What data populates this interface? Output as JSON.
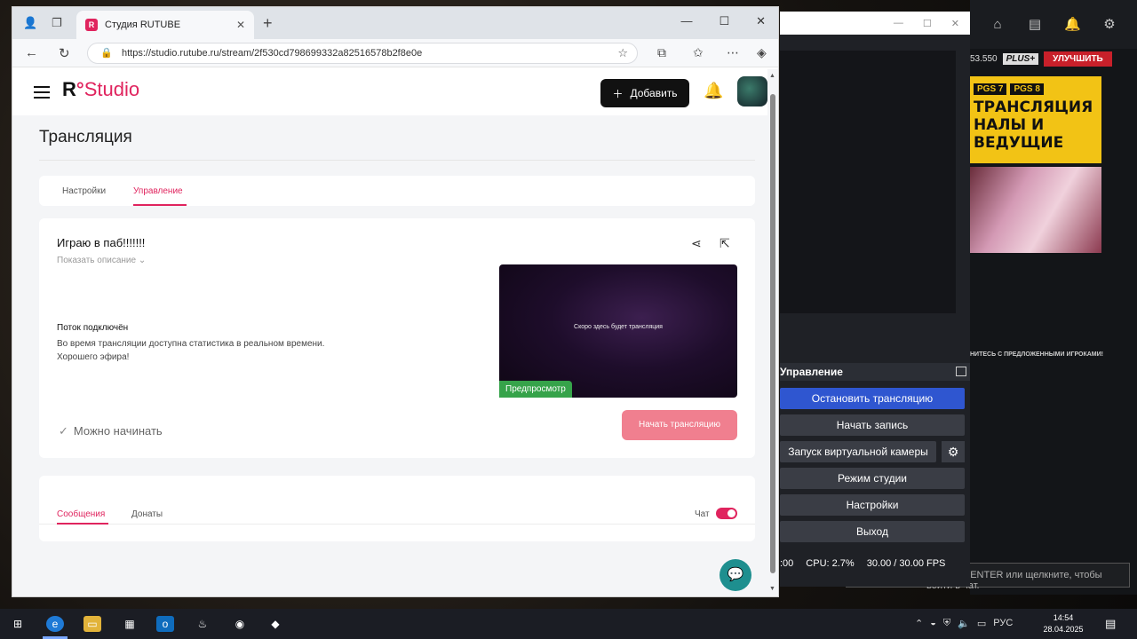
{
  "browser": {
    "tab_title": "Студия RUTUBE",
    "url": "https://studio.rutube.ru/stream/2f530cd798699332a82516578b2f8e0e"
  },
  "header": {
    "logo_r": "R",
    "logo_studio": "Studio",
    "add_button": "Добавить"
  },
  "page": {
    "title": "Трансляция",
    "tabs": [
      {
        "label": "Настройки"
      },
      {
        "label": "Управление"
      }
    ],
    "stream": {
      "title": "Играю в паб!!!!!!!",
      "show_description": "Показать описание",
      "status_heading": "Поток подключён",
      "status_text": "Во время трансляции доступна статистика в реальном времени. Хорошего эфира!",
      "preview_text": "Скоро здесь будет трансляция",
      "preview_badge": "Предпросмотр",
      "ready_text": "Можно начинать",
      "start_button": "Начать трансляцию"
    },
    "chat": {
      "tabs": [
        {
          "label": "Сообщения"
        },
        {
          "label": "Донаты"
        }
      ],
      "chat_label": "Чат"
    }
  },
  "obs": {
    "controls_title": "Управление",
    "buttons": [
      {
        "label": "Остановить трансляцию"
      },
      {
        "label": "Начать запись"
      },
      {
        "label": "Запуск виртуальной камеры"
      },
      {
        "label": "Режим студии"
      },
      {
        "label": "Настройки"
      },
      {
        "label": "Выход"
      }
    ],
    "status_time": ":00",
    "cpu": "CPU: 2.7%",
    "fps": "30.00 / 30.00 FPS"
  },
  "right_panel": {
    "balance": "53.550",
    "plus": "PLUS+",
    "upgrade": "УЛУЧШИТЬ",
    "tag1": "PGS 7",
    "tag2": "PGS 8",
    "banner_text": "ТРАНСЛЯЦИЯ НАЛЫ И ВЕДУЩИЕ",
    "invite": "НИТЕСЬ С ПРЕДЛОЖЕННЫМИ ИГРОКАМИ!",
    "chat_hint": "Нажмите ENTER или щелкните, чтобы войти в чат."
  },
  "taskbar": {
    "lang": "РУС",
    "time": "14:54",
    "date": "28.04.2025"
  }
}
